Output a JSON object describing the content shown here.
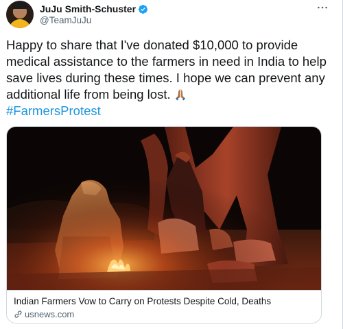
{
  "author": {
    "display_name": "JuJu Smith-Schuster",
    "handle": "@TeamJuJu",
    "verified": true
  },
  "tweet": {
    "text": "Happy to share that I've donated $10,000 to provide medical assistance to the farmers in need in India to help save lives during these times. I hope we can prevent any additional life from being lost.",
    "emoji": "folded-hands",
    "hashtag": "#FarmersProtest"
  },
  "card": {
    "title": "Indian Farmers Vow to Carry on Protests Despite Cold, Deaths",
    "domain": "usnews.com"
  },
  "colors": {
    "link_blue": "#1b95e0",
    "verified_blue": "#1da1f2",
    "secondary_text": "#536471",
    "border": "#cfd9de"
  },
  "icons": {
    "verified": "verified-badge-icon",
    "more": "more-options-icon",
    "link": "link-icon",
    "emoji": "folded-hands-icon"
  }
}
